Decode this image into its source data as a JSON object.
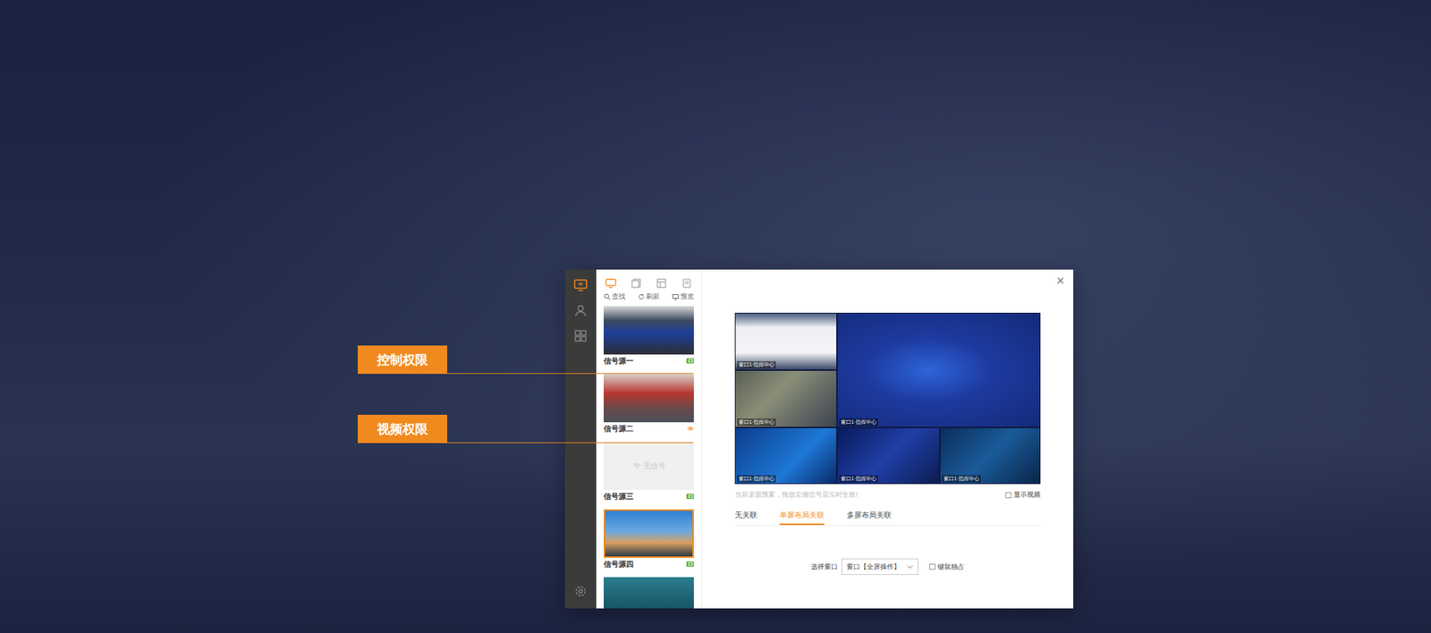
{
  "annotations": [
    {
      "label": "控制权限"
    },
    {
      "label": "视频权限"
    }
  ],
  "sidebar": {
    "items": [
      {
        "kind": "signal",
        "selected": true
      },
      {
        "kind": "user",
        "selected": false
      },
      {
        "kind": "grid",
        "selected": false
      }
    ],
    "settings": {
      "kind": "gear"
    }
  },
  "source_panel": {
    "tabs": [
      {
        "kind": "monitor",
        "selected": true
      },
      {
        "kind": "doc",
        "selected": false
      },
      {
        "kind": "layout",
        "selected": false
      },
      {
        "kind": "device",
        "selected": false
      }
    ],
    "toolbar": [
      {
        "kind": "search",
        "label": "查找"
      },
      {
        "kind": "refresh",
        "label": "刷新"
      },
      {
        "kind": "preview",
        "label": "预览"
      }
    ],
    "sources": [
      {
        "label": "信号源一",
        "signal": true,
        "selected": false,
        "badge": "control",
        "color": "#5cb33a"
      },
      {
        "label": "信号源二",
        "signal": true,
        "selected": false,
        "badge": "video",
        "color": "#f08a1e"
      },
      {
        "label": "信号源三",
        "signal": false,
        "placeholder": "无信号",
        "selected": false,
        "badge": "control",
        "color": "#5cb33a"
      },
      {
        "label": "信号源四",
        "signal": true,
        "selected": true,
        "badge": "control",
        "color": "#5cb33a"
      },
      {
        "signal": true,
        "selected": false
      }
    ]
  },
  "close": "×",
  "preview": {
    "tiles": [
      {
        "caption": "窗口1·指挥中心"
      },
      {
        "caption": "窗口1·指挥中心"
      },
      {
        "caption": "窗口1·指挥中心"
      },
      {
        "caption": "窗口1·指挥中心"
      },
      {
        "caption": "窗口1·指挥中心"
      },
      {
        "caption": "窗口1·指挥中心"
      }
    ],
    "hint": "当前桌面预案，拖放左侧信号后实时生效!",
    "show_video": {
      "label": "显示视频",
      "checked": false
    }
  },
  "relation_tabs": [
    {
      "label": "无关联",
      "selected": false
    },
    {
      "label": "单屏布局关联",
      "selected": true
    },
    {
      "label": "多屏布局关联",
      "selected": false
    }
  ],
  "window_select": {
    "label": "选择窗口",
    "value": "窗口【全屏操作】"
  },
  "exclusive": {
    "label": "键鼠独占",
    "checked": false
  }
}
